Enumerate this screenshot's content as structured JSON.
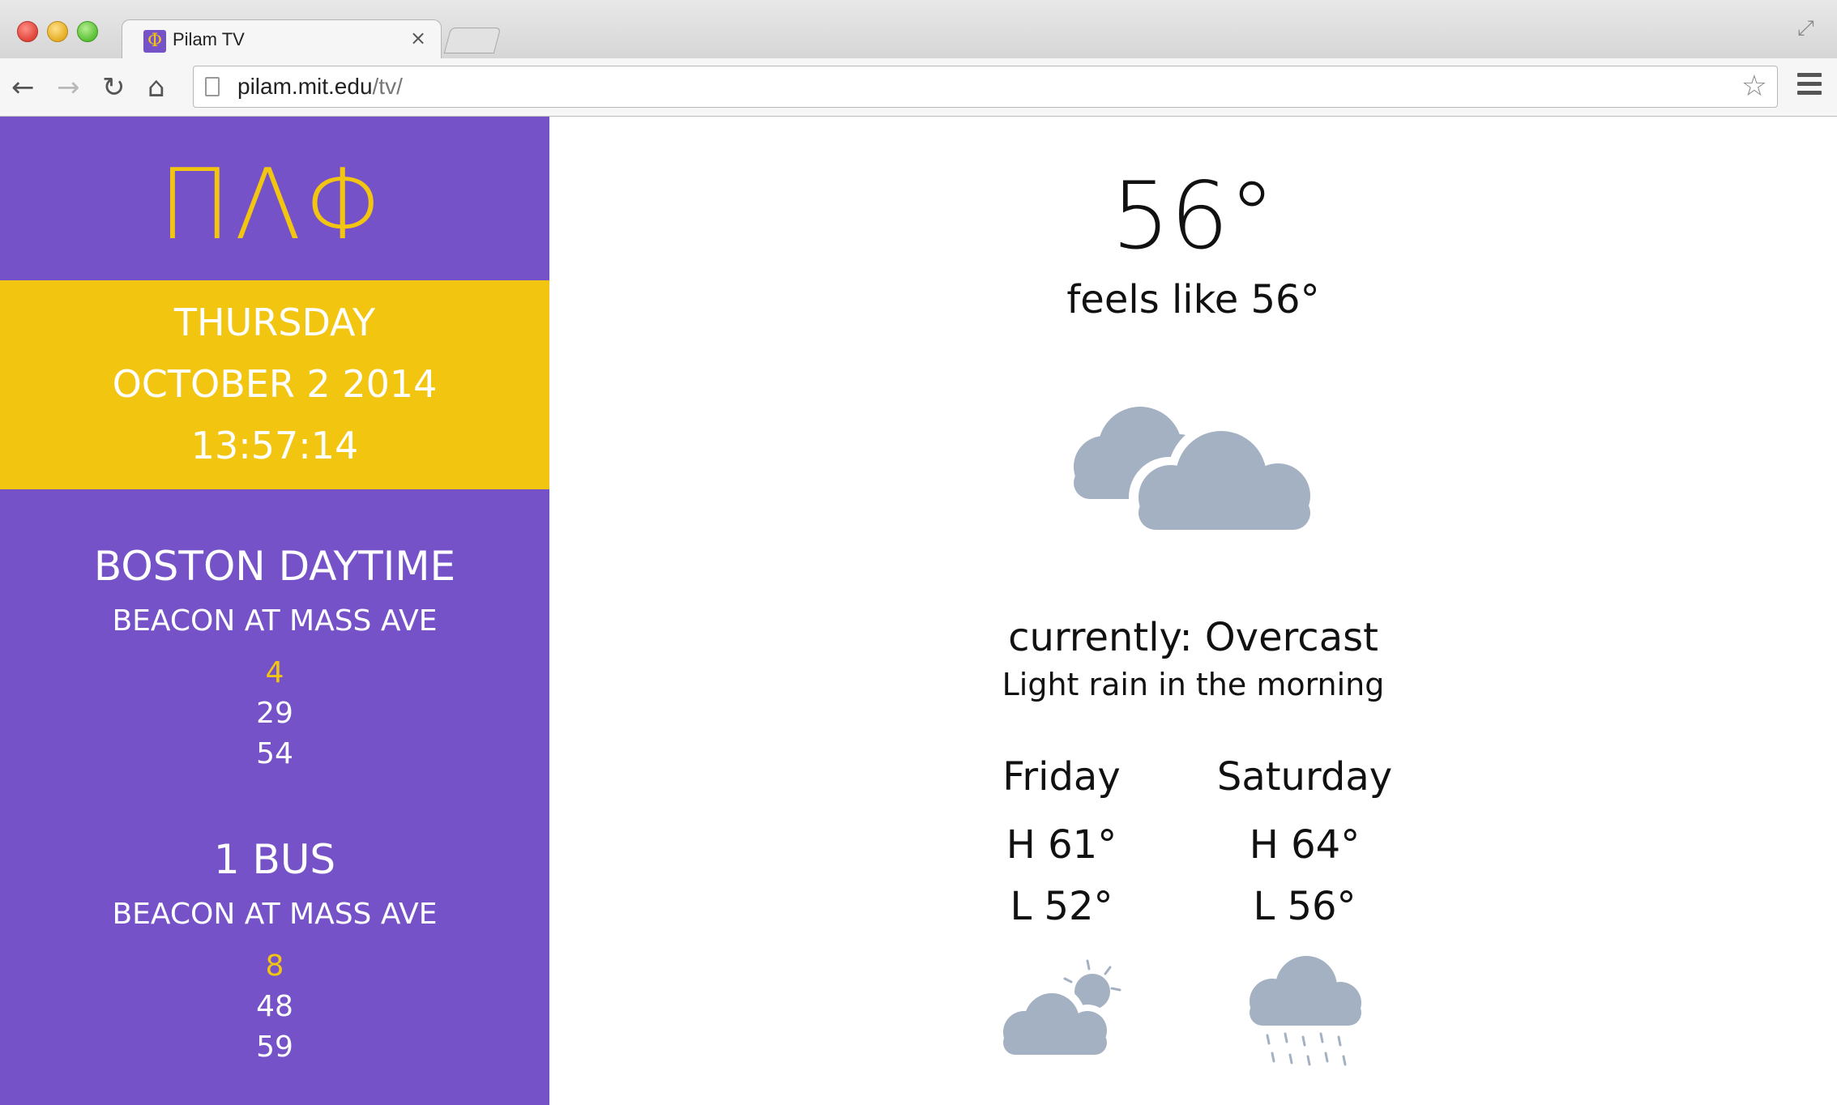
{
  "browser": {
    "tab_title": "Pilam TV",
    "tab_favicon_glyph": "Φ",
    "tab_close": "×",
    "url_host": "pilam.mit.edu",
    "url_path": "/tv/"
  },
  "sidebar": {
    "logo": "ΠΛΦ",
    "date": {
      "weekday": "THURSDAY",
      "date": "OCTOBER 2 2014",
      "time": "13:57:14"
    },
    "routes": [
      {
        "name": "BOSTON DAYTIME",
        "stop": "BEACON AT MASS AVE",
        "predictions": [
          "4",
          "29",
          "54"
        ]
      },
      {
        "name": "1 BUS",
        "stop": "BEACON AT MASS AVE",
        "predictions": [
          "8",
          "48",
          "59"
        ]
      }
    ]
  },
  "weather": {
    "temperature": "56°",
    "feels_like": "feels like 56°",
    "current_icon": "cloudy-icon",
    "currently": "currently: Overcast",
    "summary": "Light rain in the morning",
    "forecast": [
      {
        "day": "Friday",
        "high": "H 61°",
        "low": "L 52°",
        "icon": "partly-cloudy-day-icon"
      },
      {
        "day": "Saturday",
        "high": "H 64°",
        "low": "L 56°",
        "icon": "rain-icon"
      }
    ]
  },
  "colors": {
    "sidebar_purple": "#7652c9",
    "accent_yellow": "#f2c511",
    "icon_gray": "#a3b1c2"
  }
}
